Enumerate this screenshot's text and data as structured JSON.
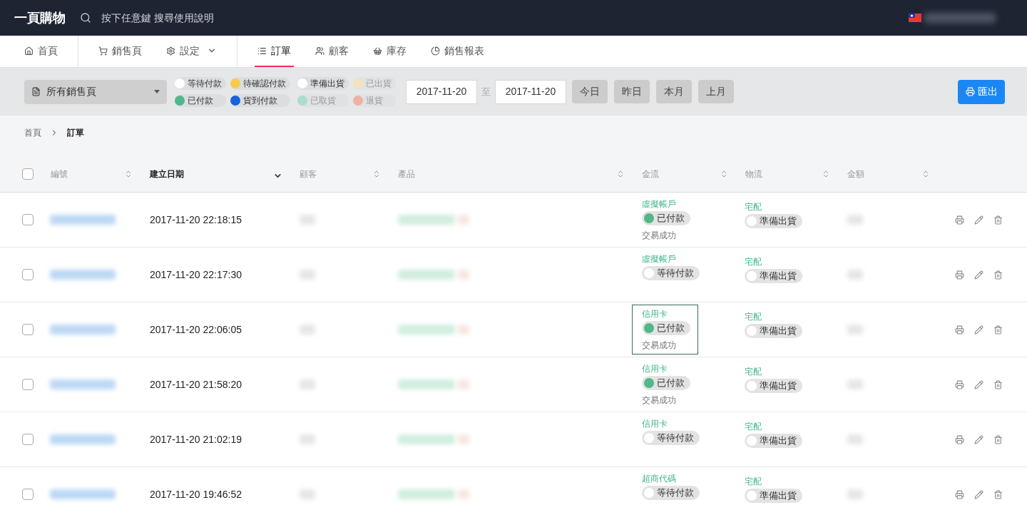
{
  "header": {
    "logo": "一頁購物",
    "search_hint": "按下任意鍵 搜尋使用說明"
  },
  "nav": [
    {
      "label": "首頁",
      "selected": false
    },
    {
      "label": "銷售頁",
      "selected": false
    },
    {
      "label": "設定",
      "selected": false,
      "dropdown": true
    },
    {
      "label": "訂單",
      "selected": true
    },
    {
      "label": "顧客",
      "selected": false
    },
    {
      "label": "庫存",
      "selected": false
    },
    {
      "label": "銷售報表",
      "selected": false
    }
  ],
  "toolbar": {
    "page_select": "所有銷售頁",
    "payment_filters": [
      {
        "label": "等待付款",
        "color": "#ffffff",
        "dimmed": false
      },
      {
        "label": "待確認付款",
        "color": "#f7cb4d",
        "dimmed": false
      },
      {
        "label": "已付款",
        "color": "#52b788",
        "dimmed": false
      },
      {
        "label": "貨到付款",
        "color": "#1565d8",
        "dimmed": false
      }
    ],
    "shipping_filters": [
      {
        "label": "準備出貨",
        "color": "#ffffff",
        "dimmed": false
      },
      {
        "label": "已出貨",
        "color": "#f3e3b8",
        "dimmed": true
      },
      {
        "label": "已取貨",
        "color": "#acdccc",
        "dimmed": true
      },
      {
        "label": "退貨",
        "color": "#efb1a6",
        "dimmed": true
      }
    ],
    "date_from": "2017-11-20",
    "range_sep": "至",
    "date_to": "2017-11-20",
    "quick_ranges": [
      "今日",
      "昨日",
      "本月",
      "上月"
    ],
    "export": "匯出"
  },
  "breadcrumb": [
    {
      "label": "首頁",
      "current": false
    },
    {
      "label": "訂單",
      "current": true
    }
  ],
  "table": {
    "select_all_checked": false,
    "columns": [
      {
        "label": "編號",
        "sorted": false
      },
      {
        "label": "建立日期",
        "sorted": true
      },
      {
        "label": "顧客",
        "sorted": false
      },
      {
        "label": "產品",
        "sorted": false
      },
      {
        "label": "金流",
        "sorted": false
      },
      {
        "label": "物流",
        "sorted": false
      },
      {
        "label": "金額",
        "sorted": false
      }
    ],
    "rows": [
      {
        "checked": false,
        "created": "2017-11-20 22:18:15",
        "highlighted": false,
        "payment": {
          "method": "虛擬帳戶",
          "status": "已付款",
          "color": "#52b788",
          "note": "交易成功"
        },
        "shipping": {
          "method": "宅配",
          "status": "準備出貨",
          "color": "#ffffff"
        }
      },
      {
        "checked": false,
        "created": "2017-11-20 22:17:30",
        "highlighted": false,
        "payment": {
          "method": "虛擬帳戶",
          "status": "等待付款",
          "color": "#ffffff"
        },
        "shipping": {
          "method": "宅配",
          "status": "準備出貨",
          "color": "#ffffff"
        }
      },
      {
        "checked": false,
        "created": "2017-11-20 22:06:05",
        "highlighted": true,
        "payment": {
          "method": "信用卡",
          "status": "已付款",
          "color": "#52b788",
          "note": "交易成功"
        },
        "shipping": {
          "method": "宅配",
          "status": "準備出貨",
          "color": "#ffffff"
        }
      },
      {
        "checked": false,
        "created": "2017-11-20 21:58:20",
        "highlighted": false,
        "payment": {
          "method": "信用卡",
          "status": "已付款",
          "color": "#52b788",
          "note": "交易成功"
        },
        "shipping": {
          "method": "宅配",
          "status": "準備出貨",
          "color": "#ffffff"
        }
      },
      {
        "checked": false,
        "created": "2017-11-20 21:02:19",
        "highlighted": false,
        "payment": {
          "method": "信用卡",
          "status": "等待付款",
          "color": "#ffffff"
        },
        "shipping": {
          "method": "宅配",
          "status": "準備出貨",
          "color": "#ffffff"
        }
      },
      {
        "checked": false,
        "created": "2017-11-20 19:46:52",
        "highlighted": false,
        "payment": {
          "method": "超商代碼",
          "status": "等待付款",
          "color": "#ffffff"
        },
        "shipping": {
          "method": "宅配",
          "status": "準備出貨",
          "color": "#ffffff"
        }
      }
    ]
  }
}
